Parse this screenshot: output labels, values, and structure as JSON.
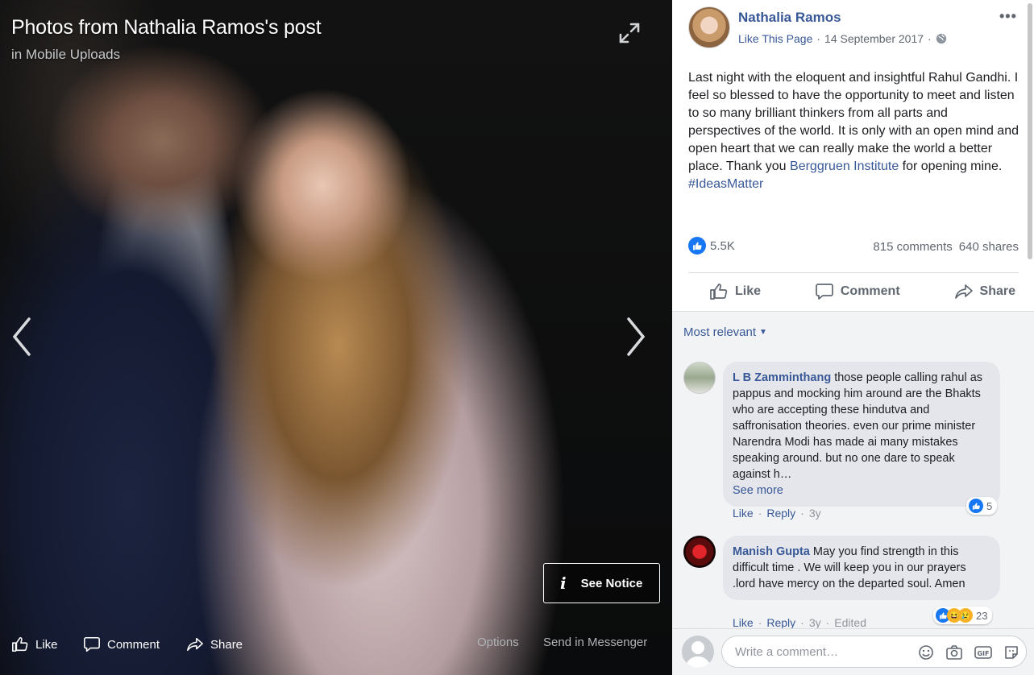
{
  "viewer": {
    "title": "Photos from Nathalia Ramos's post",
    "subtitle": "in Mobile Uploads",
    "see_notice": "See Notice",
    "bar": {
      "like": "Like",
      "comment": "Comment",
      "share": "Share",
      "options": "Options",
      "send": "Send in Messenger"
    }
  },
  "post": {
    "author": "Nathalia Ramos",
    "like_page": "Like This Page",
    "date": "14 September 2017",
    "text_main": "Last night with the eloquent and insightful Rahul Gandhi. I feel so blessed to have the opportunity to meet and listen to so many brilliant thinkers from all parts and perspectives of the world. It is only with an open mind and open heart that we can really make the world a better place. Thank you ",
    "text_link": "Berggruen Institute",
    "text_after": " for opening mine. ",
    "hashtag": "#IdeasMatter",
    "reactions_count": "5.5K",
    "comments_count": "815 comments",
    "shares_count": "640 shares",
    "actions": {
      "like": "Like",
      "comment": "Comment",
      "share": "Share"
    },
    "sort": "Most relevant"
  },
  "comments": [
    {
      "name": "L B Zamminthang",
      "text": "those people calling rahul as pappus and mocking him around are the Bhakts who are accepting these hindutva and saffronisation theories. even our prime minister Narendra Modi has made ai many mistakes speaking around. but no one dare to speak against h…",
      "see_more": "See more",
      "like": "Like",
      "reply": "Reply",
      "age": "3y",
      "reaction_count": "5"
    },
    {
      "name": "Manish Gupta",
      "text": "May you find strength in this difficult time . We will keep you in our prayers .lord have mercy on the departed soul. Amen",
      "like": "Like",
      "reply": "Reply",
      "age": "3y",
      "edited": "Edited",
      "reaction_count": "23"
    }
  ],
  "composer": {
    "placeholder": "Write a comment…"
  },
  "colors": {
    "link": "#385898",
    "like_blue": "#1877f2",
    "panel_bg": "#f2f3f5"
  }
}
